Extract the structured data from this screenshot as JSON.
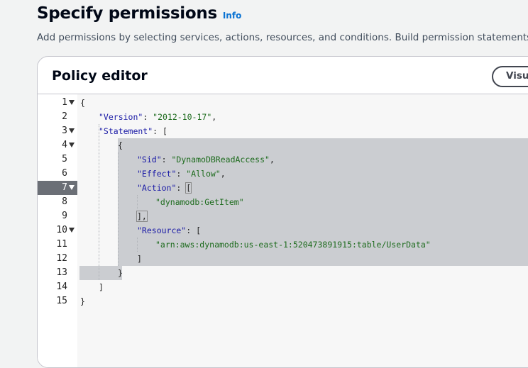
{
  "header": {
    "title": "Specify permissions",
    "info": "Info",
    "description": "Add permissions by selecting services, actions, resources, and conditions. Build permission statements using th"
  },
  "panel": {
    "title": "Policy editor",
    "visual_button": "Visual"
  },
  "editor": {
    "active_line": 7,
    "line_numbers": [
      "1",
      "2",
      "3",
      "4",
      "5",
      "6",
      "7",
      "8",
      "9",
      "10",
      "11",
      "12",
      "13",
      "14",
      "15"
    ],
    "tokens": {
      "open_brace": "{",
      "close_brace": "}",
      "open_bracket": "[",
      "close_bracket": "]",
      "version_key": "\"Version\"",
      "version_val": "\"2012-10-17\"",
      "statement_key": "\"Statement\"",
      "sid_key": "\"Sid\"",
      "sid_val": "\"DynamoDBReadAccess\"",
      "effect_key": "\"Effect\"",
      "effect_val": "\"Allow\"",
      "action_key": "\"Action\"",
      "action_val": "\"dynamodb:GetItem\"",
      "resource_key": "\"Resource\"",
      "resource_val": "\"arn:aws:dynamodb:us-east-1:520473891915:table/UserData\"",
      "colon": ": ",
      "comma": ",",
      "close_bracket_comma": "],"
    }
  }
}
